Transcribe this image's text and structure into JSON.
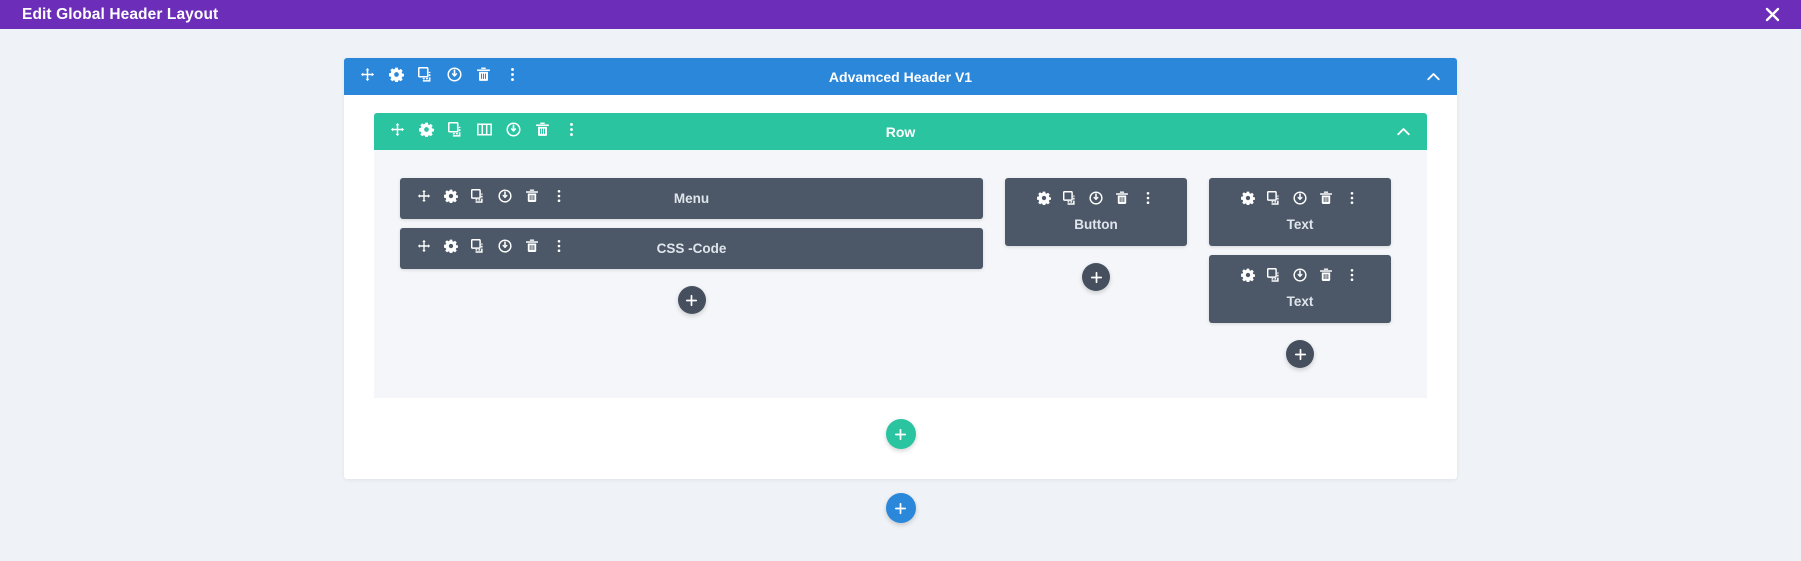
{
  "window": {
    "title": "Edit Global Header Layout",
    "close_icon": "close-icon",
    "accent_color": "#6c2eb9"
  },
  "colors": {
    "section": "#2b87da",
    "row": "#2ac4a1",
    "module": "#4c5867",
    "canvas": "#eff2f6",
    "add_module": "#454f5e"
  },
  "section": {
    "title": "Advamced Header V1",
    "collapse_icon": "chevron-up-icon",
    "toolbar": [
      {
        "name": "move-icon",
        "label": "Move"
      },
      {
        "name": "gear-icon",
        "label": "Settings"
      },
      {
        "name": "duplicate-icon",
        "label": "Duplicate"
      },
      {
        "name": "power-icon",
        "label": "Disable"
      },
      {
        "name": "trash-icon",
        "label": "Delete"
      },
      {
        "name": "more-icon",
        "label": "More Options"
      }
    ]
  },
  "row": {
    "title": "Row",
    "collapse_icon": "chevron-up-icon",
    "toolbar": [
      {
        "name": "move-icon",
        "label": "Move"
      },
      {
        "name": "gear-icon",
        "label": "Settings"
      },
      {
        "name": "duplicate-icon",
        "label": "Duplicate"
      },
      {
        "name": "columns-icon",
        "label": "Column Structure"
      },
      {
        "name": "power-icon",
        "label": "Disable"
      },
      {
        "name": "trash-icon",
        "label": "Delete"
      },
      {
        "name": "more-icon",
        "label": "More Options"
      }
    ]
  },
  "module_toolbar_full": [
    {
      "name": "move-icon",
      "label": "Move"
    },
    {
      "name": "gear-icon",
      "label": "Settings"
    },
    {
      "name": "duplicate-icon",
      "label": "Duplicate"
    },
    {
      "name": "power-icon",
      "label": "Disable"
    },
    {
      "name": "trash-icon",
      "label": "Delete"
    },
    {
      "name": "more-icon",
      "label": "More Options"
    }
  ],
  "module_toolbar_compact": [
    {
      "name": "gear-icon",
      "label": "Settings"
    },
    {
      "name": "duplicate-icon",
      "label": "Duplicate"
    },
    {
      "name": "power-icon",
      "label": "Disable"
    },
    {
      "name": "trash-icon",
      "label": "Delete"
    },
    {
      "name": "more-icon",
      "label": "More Options"
    }
  ],
  "columns": [
    {
      "id": "column-1",
      "modules": [
        {
          "title": "Menu",
          "layout": "inline"
        },
        {
          "title": "CSS -Code",
          "layout": "inline"
        }
      ],
      "add_module_label": "+"
    },
    {
      "id": "column-2",
      "modules": [
        {
          "title": "Button",
          "layout": "stack"
        }
      ],
      "add_module_label": "+"
    },
    {
      "id": "column-3",
      "modules": [
        {
          "title": "Text",
          "layout": "stack"
        },
        {
          "title": "Text",
          "layout": "stack"
        }
      ],
      "add_module_label": "+"
    }
  ],
  "add_row_label": "+",
  "add_section_label": "+"
}
